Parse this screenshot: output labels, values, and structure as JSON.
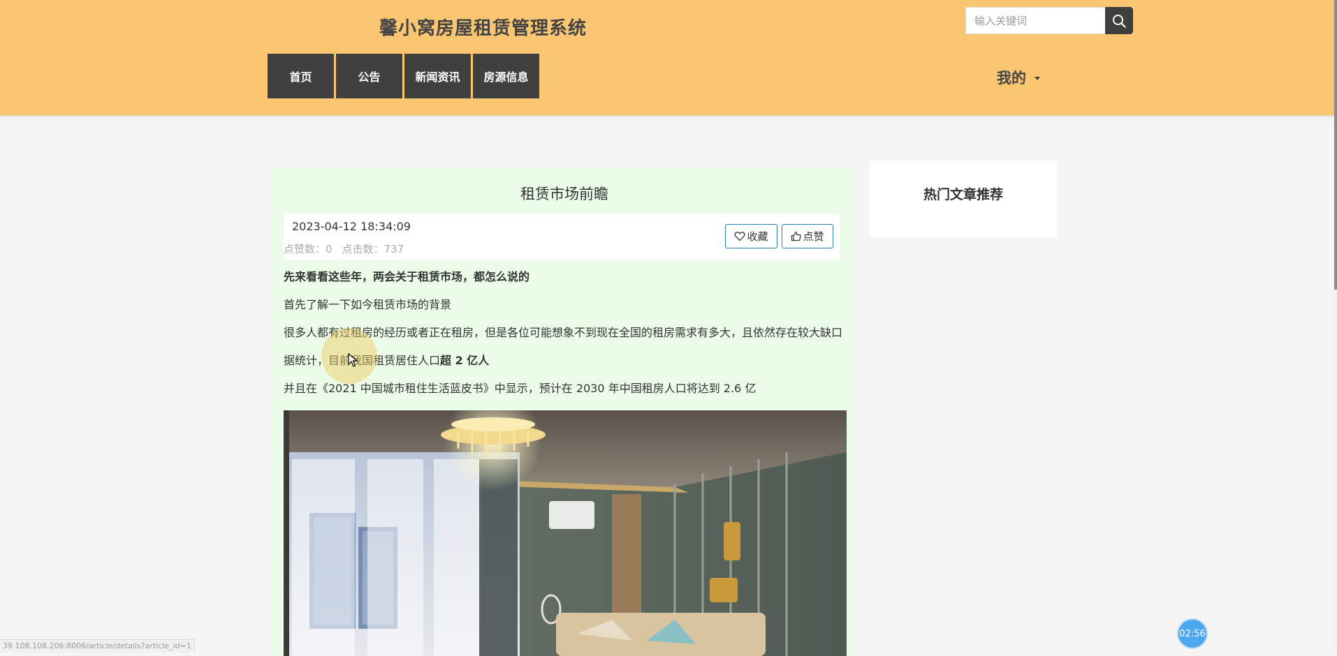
{
  "header": {
    "site_title": "馨小窝房屋租赁管理系统",
    "search_placeholder": "输入关键词",
    "nav": [
      {
        "label": "首页"
      },
      {
        "label": "公告"
      },
      {
        "label": "新闻资讯"
      },
      {
        "label": "房源信息"
      }
    ],
    "my_menu": "我的"
  },
  "article": {
    "title": "租赁市场前瞻",
    "date": "2023-04-12 18:34:09",
    "likes_text": "点赞数：0",
    "clicks_text": "点击数：737",
    "fav_label": "收藏",
    "like_label": "点赞",
    "paragraphs": {
      "p1": "先来看看这些年，两会关于租赁市场，都怎么说的",
      "p2": "首先了解一下如今租赁市场的背景",
      "p3": "很多人都有过租房的经历或者正在租房，但是各位可能想象不到现在全国的租房需求有多大，且依然存在较大缺口",
      "p4_a": "据统计，目前我国租赁居住人口",
      "p4_b": "超 2 亿人",
      "p5": "并且在《2021 中国城市租住生活蓝皮书》中显示，预计在 2030 年中国租房人口将达到 2.6 亿"
    }
  },
  "sidebar": {
    "title": "热门文章推荐"
  },
  "status": {
    "url": "39.108.108.206:8006/article/details?article_id=1",
    "timer": "02:56"
  },
  "colors": {
    "header_bg": "#fac672",
    "nav_bg": "#404040",
    "article_bg": "#ebfde8",
    "button_border": "#2b7aa8"
  }
}
